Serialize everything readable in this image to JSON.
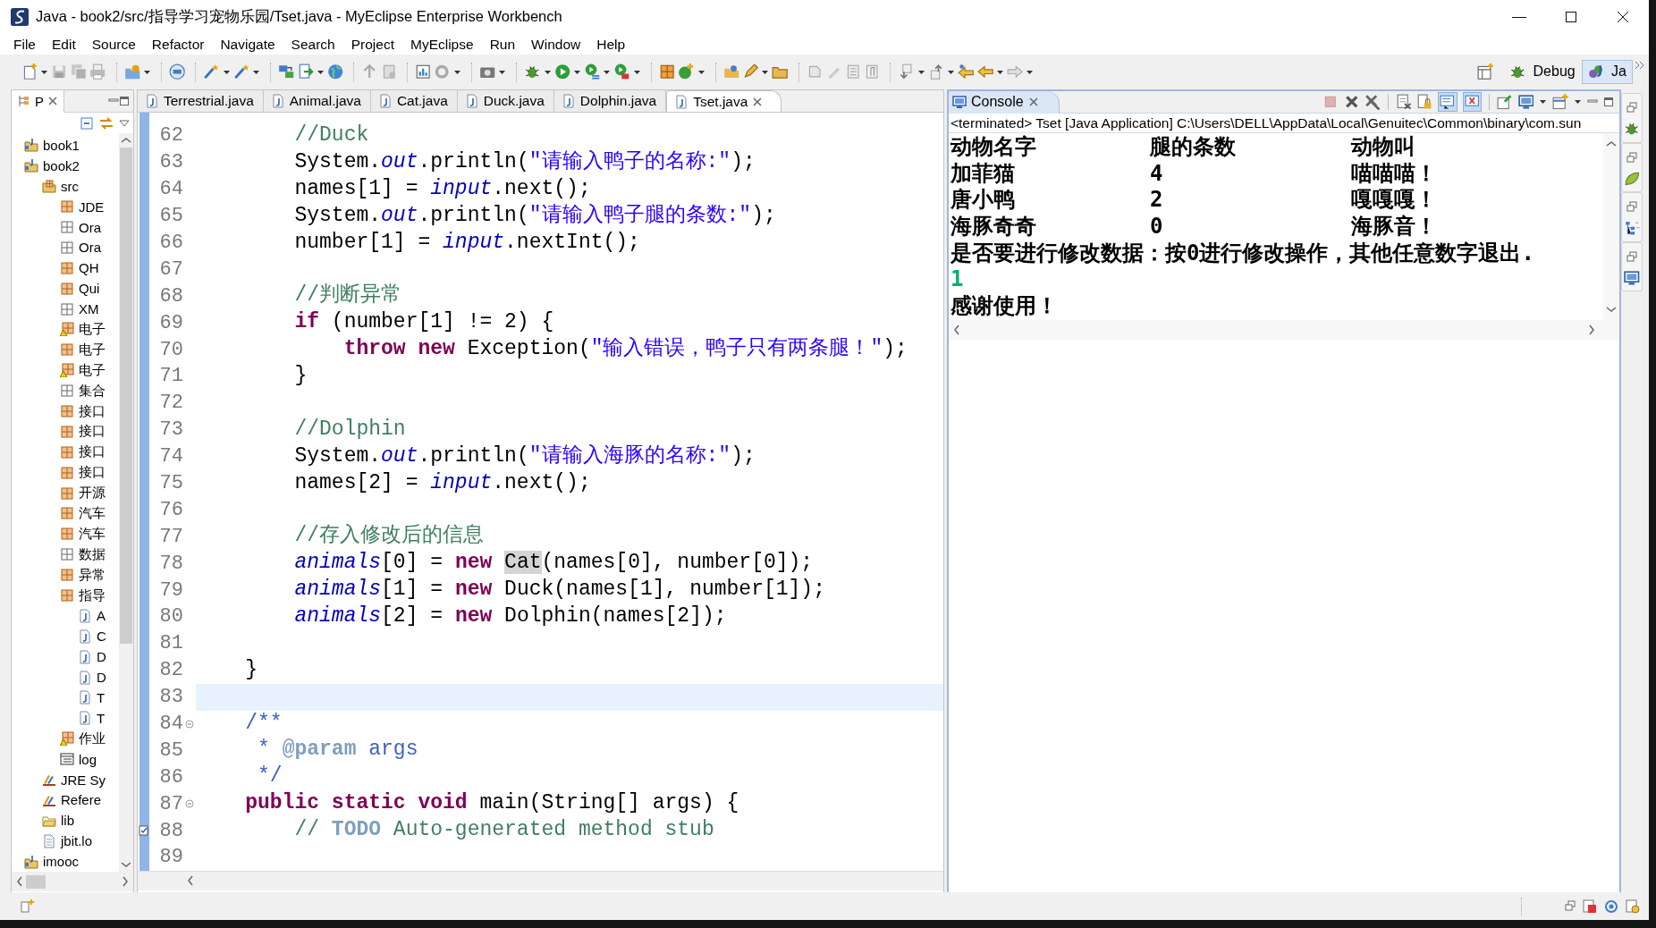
{
  "window": {
    "title": "Java - book2/src/指导学习宠物乐园/Tset.java - MyEclipse Enterprise Workbench"
  },
  "menu": [
    "File",
    "Edit",
    "Source",
    "Refactor",
    "Navigate",
    "Search",
    "Project",
    "MyEclipse",
    "Run",
    "Window",
    "Help"
  ],
  "perspectives": [
    {
      "label": "Debug",
      "selected": false
    },
    {
      "label": "Ja",
      "selected": true
    }
  ],
  "explorer": {
    "tab": {
      "label": "P",
      "selected": true
    },
    "tree": [
      {
        "label": "book1",
        "kind": "project"
      },
      {
        "label": "book2",
        "kind": "project",
        "children": [
          {
            "label": "src",
            "kind": "source-folder",
            "children": [
              {
                "label": "JDE",
                "kind": "package"
              },
              {
                "label": "Ora",
                "kind": "empty-package"
              },
              {
                "label": "Ora",
                "kind": "empty-package"
              },
              {
                "label": "QH",
                "kind": "package"
              },
              {
                "label": "Qui",
                "kind": "package"
              },
              {
                "label": "XM",
                "kind": "empty-package"
              },
              {
                "label": "电子",
                "kind": "warning-package"
              },
              {
                "label": "电子",
                "kind": "package"
              },
              {
                "label": "电子",
                "kind": "warning-package"
              },
              {
                "label": "集合",
                "kind": "empty-package"
              },
              {
                "label": "接口",
                "kind": "package"
              },
              {
                "label": "接口",
                "kind": "package"
              },
              {
                "label": "接口",
                "kind": "package"
              },
              {
                "label": "接口",
                "kind": "package"
              },
              {
                "label": "开源",
                "kind": "package"
              },
              {
                "label": "汽车",
                "kind": "package"
              },
              {
                "label": "汽车",
                "kind": "package"
              },
              {
                "label": "数据",
                "kind": "empty-package"
              },
              {
                "label": "异常",
                "kind": "package"
              },
              {
                "label": "指导",
                "kind": "package",
                "children": [
                  {
                    "label": "A",
                    "kind": "java-file"
                  },
                  {
                    "label": "C",
                    "kind": "java-file"
                  },
                  {
                    "label": "D",
                    "kind": "java-file"
                  },
                  {
                    "label": "D",
                    "kind": "java-file"
                  },
                  {
                    "label": "T",
                    "kind": "java-file"
                  },
                  {
                    "label": "T",
                    "kind": "java-file"
                  }
                ]
              },
              {
                "label": "作业",
                "kind": "warning-package"
              },
              {
                "label": "log",
                "kind": "table-file"
              }
            ]
          },
          {
            "label": "JRE Sy",
            "kind": "library"
          },
          {
            "label": "Refere",
            "kind": "library"
          },
          {
            "label": "lib",
            "kind": "folder"
          },
          {
            "label": "jbit.lo",
            "kind": "file"
          }
        ]
      },
      {
        "label": "imooc",
        "kind": "project"
      }
    ]
  },
  "editor": {
    "tabs": [
      {
        "label": "Terrestrial.java",
        "selected": false
      },
      {
        "label": "Animal.java",
        "selected": false
      },
      {
        "label": "Cat.java",
        "selected": false
      },
      {
        "label": "Duck.java",
        "selected": false
      },
      {
        "label": "Dolphin.java",
        "selected": false
      },
      {
        "label": "Tset.java",
        "selected": true
      }
    ],
    "lines": [
      {
        "number": "62",
        "current": false,
        "foldable": false,
        "task": false,
        "tokens": [
          {
            "kind": "comment",
            "text": "        //Duck"
          }
        ]
      },
      {
        "number": "63",
        "current": false,
        "foldable": false,
        "task": false,
        "tokens": [
          {
            "kind": "plain",
            "text": "        System."
          },
          {
            "kind": "field",
            "text": "out"
          },
          {
            "kind": "plain",
            "text": ".println("
          },
          {
            "kind": "string",
            "text": "\"请输入鸭子的名称:\""
          },
          {
            "kind": "plain",
            "text": ");"
          }
        ]
      },
      {
        "number": "64",
        "current": false,
        "foldable": false,
        "task": false,
        "tokens": [
          {
            "kind": "plain",
            "text": "        names[1] = "
          },
          {
            "kind": "field",
            "text": "input"
          },
          {
            "kind": "plain",
            "text": ".next();"
          }
        ]
      },
      {
        "number": "65",
        "current": false,
        "foldable": false,
        "task": false,
        "tokens": [
          {
            "kind": "plain",
            "text": "        System."
          },
          {
            "kind": "field",
            "text": "out"
          },
          {
            "kind": "plain",
            "text": ".println("
          },
          {
            "kind": "string",
            "text": "\"请输入鸭子腿的条数:\""
          },
          {
            "kind": "plain",
            "text": ");"
          }
        ]
      },
      {
        "number": "66",
        "current": false,
        "foldable": false,
        "task": false,
        "tokens": [
          {
            "kind": "plain",
            "text": "        number[1] = "
          },
          {
            "kind": "field",
            "text": "input"
          },
          {
            "kind": "plain",
            "text": ".nextInt();"
          }
        ]
      },
      {
        "number": "67",
        "current": false,
        "foldable": false,
        "task": false
      },
      {
        "number": "68",
        "current": false,
        "foldable": false,
        "task": false,
        "tokens": [
          {
            "kind": "comment",
            "text": "        //判断异常"
          }
        ]
      },
      {
        "number": "69",
        "current": false,
        "foldable": false,
        "task": false,
        "tokens": [
          {
            "kind": "keyword",
            "text": "        if"
          },
          {
            "kind": "plain",
            "text": " (number[1] != 2) {"
          }
        ]
      },
      {
        "number": "70",
        "current": false,
        "foldable": false,
        "task": false,
        "tokens": [
          {
            "kind": "keyword",
            "text": "            throw new"
          },
          {
            "kind": "plain",
            "text": " Exception("
          },
          {
            "kind": "string",
            "text": "\"输入错误，鸭子只有两条腿！\""
          },
          {
            "kind": "plain",
            "text": ");"
          }
        ]
      },
      {
        "number": "71",
        "current": false,
        "foldable": false,
        "task": false,
        "tokens": [
          {
            "kind": "plain",
            "text": "        }"
          }
        ]
      },
      {
        "number": "72",
        "current": false,
        "foldable": false,
        "task": false
      },
      {
        "number": "73",
        "current": false,
        "foldable": false,
        "task": false,
        "tokens": [
          {
            "kind": "comment",
            "text": "        //Dolphin"
          }
        ]
      },
      {
        "number": "74",
        "current": false,
        "foldable": false,
        "task": false,
        "tokens": [
          {
            "kind": "plain",
            "text": "        System."
          },
          {
            "kind": "field",
            "text": "out"
          },
          {
            "kind": "plain",
            "text": ".println("
          },
          {
            "kind": "string",
            "text": "\"请输入海豚的名称:\""
          },
          {
            "kind": "plain",
            "text": ");"
          }
        ]
      },
      {
        "number": "75",
        "current": false,
        "foldable": false,
        "task": false,
        "tokens": [
          {
            "kind": "plain",
            "text": "        names[2] = "
          },
          {
            "kind": "field",
            "text": "input"
          },
          {
            "kind": "plain",
            "text": ".next();"
          }
        ]
      },
      {
        "number": "76",
        "current": false,
        "foldable": false,
        "task": false
      },
      {
        "number": "77",
        "current": false,
        "foldable": false,
        "task": false,
        "tokens": [
          {
            "kind": "comment",
            "text": "        //存入修改后的信息"
          }
        ]
      },
      {
        "number": "78",
        "current": false,
        "foldable": false,
        "task": false,
        "tokens": [
          {
            "kind": "field",
            "text": "        animals"
          },
          {
            "kind": "plain",
            "text": "[0] = "
          },
          {
            "kind": "keyword",
            "text": "new "
          },
          {
            "kind": "occurrence",
            "text": "Cat"
          },
          {
            "kind": "plain",
            "text": "(names[0], number[0]);"
          }
        ]
      },
      {
        "number": "79",
        "current": false,
        "foldable": false,
        "task": false,
        "tokens": [
          {
            "kind": "field",
            "text": "        animals"
          },
          {
            "kind": "plain",
            "text": "[1] = "
          },
          {
            "kind": "keyword",
            "text": "new"
          },
          {
            "kind": "plain",
            "text": " Duck(names[1], number[1]);"
          }
        ]
      },
      {
        "number": "80",
        "current": false,
        "foldable": false,
        "task": false,
        "tokens": [
          {
            "kind": "field",
            "text": "        animals"
          },
          {
            "kind": "plain",
            "text": "[2] = "
          },
          {
            "kind": "keyword",
            "text": "new"
          },
          {
            "kind": "plain",
            "text": " Dolphin(names[2]);"
          }
        ]
      },
      {
        "number": "81",
        "current": false,
        "foldable": false,
        "task": false
      },
      {
        "number": "82",
        "current": false,
        "foldable": false,
        "task": false,
        "tokens": [
          {
            "kind": "plain",
            "text": "    }"
          }
        ]
      },
      {
        "number": "83",
        "current": true,
        "foldable": false,
        "task": false
      },
      {
        "number": "84",
        "current": false,
        "foldable": true,
        "task": false,
        "tokens": [
          {
            "kind": "javadoc",
            "text": "    /**"
          }
        ]
      },
      {
        "number": "85",
        "current": false,
        "foldable": false,
        "task": false,
        "tokens": [
          {
            "kind": "javadoc",
            "text": "     * "
          },
          {
            "kind": "tag",
            "text": "@param"
          },
          {
            "kind": "javadoc",
            "text": " args"
          }
        ]
      },
      {
        "number": "86",
        "current": false,
        "foldable": false,
        "task": false,
        "tokens": [
          {
            "kind": "javadoc",
            "text": "     */"
          }
        ]
      },
      {
        "number": "87",
        "current": false,
        "foldable": true,
        "task": false,
        "tokens": [
          {
            "kind": "keyword",
            "text": "    public static void"
          },
          {
            "kind": "plain",
            "text": " main(String[] args) {"
          }
        ]
      },
      {
        "number": "88",
        "current": false,
        "foldable": false,
        "task": true,
        "tokens": [
          {
            "kind": "comment",
            "text": "        // "
          },
          {
            "kind": "todo",
            "text": "TODO"
          },
          {
            "kind": "comment",
            "text": " Auto-generated method stub"
          }
        ]
      },
      {
        "number": "89",
        "current": false,
        "foldable": false,
        "task": false
      }
    ]
  },
  "console": {
    "tab": {
      "label": "Console",
      "selected": true
    },
    "show_on_output": true,
    "show_on_error": true,
    "status": "<terminated> Tset [Java Application] C:\\Users\\DELL\\AppData\\Local\\Genuitec\\Common\\binary\\com.sun",
    "output": [
      {
        "kind": "columns",
        "cells": [
          "动物名字",
          "腿的条数",
          "动物叫"
        ]
      },
      {
        "kind": "columns",
        "cells": [
          "加菲猫",
          "4",
          "喵喵喵！"
        ]
      },
      {
        "kind": "columns",
        "cells": [
          "唐小鸭",
          "2",
          "嘎嘎嘎！"
        ]
      },
      {
        "kind": "columns",
        "cells": [
          "海豚奇奇",
          "0",
          "海豚音！"
        ]
      },
      {
        "kind": "text",
        "text": "是否要进行修改数据：按0进行修改操作，其他任意数字退出."
      },
      {
        "kind": "input",
        "text": "1"
      },
      {
        "kind": "text",
        "text": "感谢使用！"
      }
    ]
  }
}
